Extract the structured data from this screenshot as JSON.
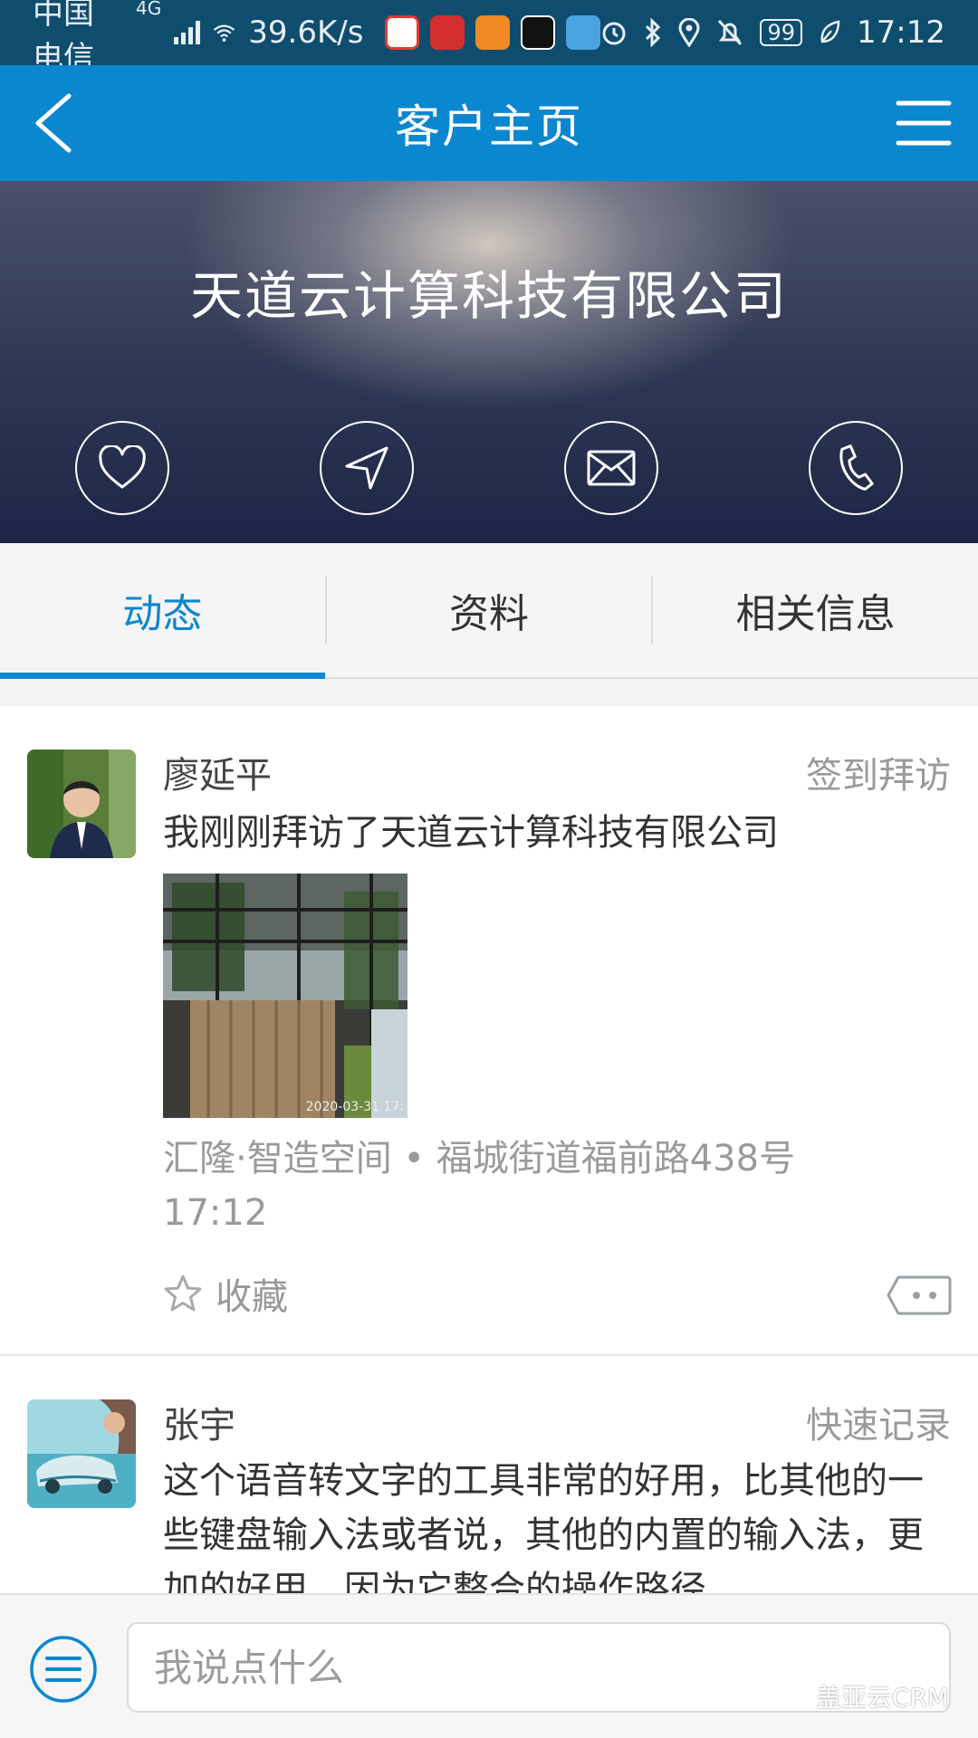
{
  "status_bar": {
    "carrier": "中国电信",
    "network": "4G",
    "speed": "39.6K/s",
    "battery": "99",
    "time": "17:12",
    "app_icons": [
      "du-icon",
      "ifeng-icon",
      "video-icon",
      "p-app-icon",
      "browser-icon"
    ],
    "status_icons": [
      "alarm-icon",
      "bluetooth-icon",
      "location-icon",
      "mute-icon",
      "leaf-icon"
    ]
  },
  "header": {
    "title": "客户主页",
    "back_icon": "chevron-left-icon",
    "menu_icon": "hamburger-icon"
  },
  "hero": {
    "company_name": "天道云计算科技有限公司",
    "actions": [
      "heart-icon",
      "navigate-icon",
      "mail-icon",
      "phone-icon"
    ]
  },
  "tabs": [
    {
      "label": "动态",
      "active": true
    },
    {
      "label": "资料",
      "active": false
    },
    {
      "label": "相关信息",
      "active": false
    }
  ],
  "feed": [
    {
      "author": "廖延平",
      "tag": "签到拜访",
      "content": "我刚刚拜访了天道云计算科技有限公司",
      "photo_timestamp": "2020-03-31 17:",
      "location": "汇隆·智造空间 • 福城街道福前路438号",
      "time": "17:12",
      "favorite_label": "收藏"
    },
    {
      "author": "张宇",
      "tag": "快速记录",
      "content": "这个语音转文字的工具非常的好用，比其他的一些键盘输入法或者说，其他的内置的输入法，更加的好用，因为它整合的操作路径"
    }
  ],
  "composer": {
    "placeholder": "我说点什么",
    "watermark": "盖亚云CRM"
  },
  "colors": {
    "status_bar": "#0f4d6f",
    "primary": "#0b87cf",
    "tab_bg": "#f5f5f5",
    "muted_text": "#9a9a9a"
  }
}
